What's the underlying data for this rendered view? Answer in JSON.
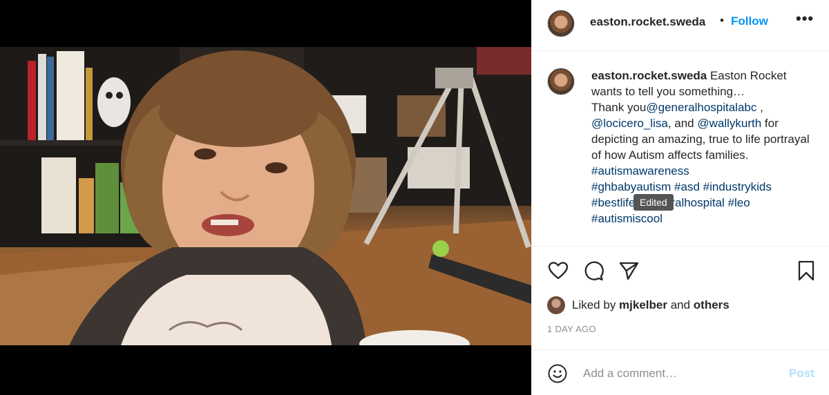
{
  "post": {
    "username": "easton.rocket.sweda",
    "separator": "•",
    "follow_label": "Follow",
    "more_label": "•••",
    "caption": {
      "username": "easton.rocket.sweda",
      "line1": " Easton Rocket wants to tell you something…",
      "line2": "Thank you",
      "mention1": "@generalhospitalabc",
      "sep1": " ,",
      "mention2": "@locicero_lisa",
      "and1": ", and ",
      "mention3": "@wallykurth",
      "line3": " for depicting an amazing, true to life portrayal of how Autism affects families.",
      "hashtags": [
        "#autismawareness",
        "#ghbabyautism",
        "#asd",
        "#industrykids",
        "#bestlife",
        "#generalhospital",
        "#leo",
        "#autismiscool"
      ]
    },
    "tooltip": "Edited",
    "likes": {
      "prefix": "Liked by ",
      "user": "mjkelber",
      "mid": " and ",
      "others": "others"
    },
    "timestamp": "1 DAY AGO",
    "comment": {
      "placeholder": "Add a comment…",
      "post_label": "Post"
    },
    "icons": [
      "heart-icon",
      "comment-icon",
      "share-icon",
      "bookmark-icon",
      "emoji-icon"
    ],
    "colors": {
      "link": "#0095f6",
      "hashtag": "#00376b",
      "post_disabled": "#b2dffc",
      "muted": "#8e8e8e"
    }
  }
}
